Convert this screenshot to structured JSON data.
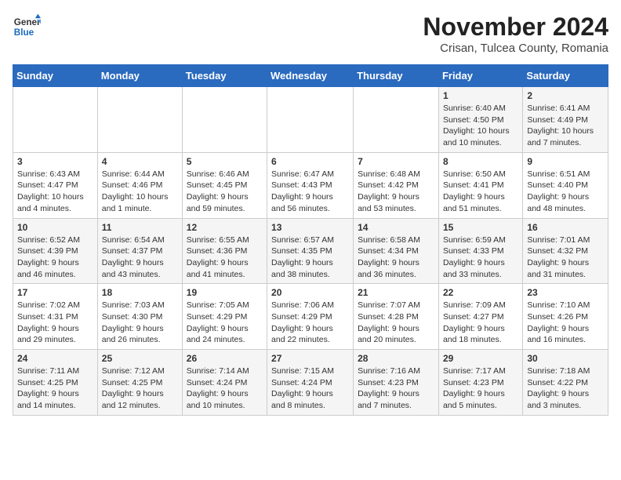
{
  "header": {
    "logo_line1": "General",
    "logo_line2": "Blue",
    "month_title": "November 2024",
    "location": "Crisan, Tulcea County, Romania"
  },
  "days_of_week": [
    "Sunday",
    "Monday",
    "Tuesday",
    "Wednesday",
    "Thursday",
    "Friday",
    "Saturday"
  ],
  "weeks": [
    [
      {
        "day": "",
        "info": ""
      },
      {
        "day": "",
        "info": ""
      },
      {
        "day": "",
        "info": ""
      },
      {
        "day": "",
        "info": ""
      },
      {
        "day": "",
        "info": ""
      },
      {
        "day": "1",
        "info": "Sunrise: 6:40 AM\nSunset: 4:50 PM\nDaylight: 10 hours and 10 minutes."
      },
      {
        "day": "2",
        "info": "Sunrise: 6:41 AM\nSunset: 4:49 PM\nDaylight: 10 hours and 7 minutes."
      }
    ],
    [
      {
        "day": "3",
        "info": "Sunrise: 6:43 AM\nSunset: 4:47 PM\nDaylight: 10 hours and 4 minutes."
      },
      {
        "day": "4",
        "info": "Sunrise: 6:44 AM\nSunset: 4:46 PM\nDaylight: 10 hours and 1 minute."
      },
      {
        "day": "5",
        "info": "Sunrise: 6:46 AM\nSunset: 4:45 PM\nDaylight: 9 hours and 59 minutes."
      },
      {
        "day": "6",
        "info": "Sunrise: 6:47 AM\nSunset: 4:43 PM\nDaylight: 9 hours and 56 minutes."
      },
      {
        "day": "7",
        "info": "Sunrise: 6:48 AM\nSunset: 4:42 PM\nDaylight: 9 hours and 53 minutes."
      },
      {
        "day": "8",
        "info": "Sunrise: 6:50 AM\nSunset: 4:41 PM\nDaylight: 9 hours and 51 minutes."
      },
      {
        "day": "9",
        "info": "Sunrise: 6:51 AM\nSunset: 4:40 PM\nDaylight: 9 hours and 48 minutes."
      }
    ],
    [
      {
        "day": "10",
        "info": "Sunrise: 6:52 AM\nSunset: 4:39 PM\nDaylight: 9 hours and 46 minutes."
      },
      {
        "day": "11",
        "info": "Sunrise: 6:54 AM\nSunset: 4:37 PM\nDaylight: 9 hours and 43 minutes."
      },
      {
        "day": "12",
        "info": "Sunrise: 6:55 AM\nSunset: 4:36 PM\nDaylight: 9 hours and 41 minutes."
      },
      {
        "day": "13",
        "info": "Sunrise: 6:57 AM\nSunset: 4:35 PM\nDaylight: 9 hours and 38 minutes."
      },
      {
        "day": "14",
        "info": "Sunrise: 6:58 AM\nSunset: 4:34 PM\nDaylight: 9 hours and 36 minutes."
      },
      {
        "day": "15",
        "info": "Sunrise: 6:59 AM\nSunset: 4:33 PM\nDaylight: 9 hours and 33 minutes."
      },
      {
        "day": "16",
        "info": "Sunrise: 7:01 AM\nSunset: 4:32 PM\nDaylight: 9 hours and 31 minutes."
      }
    ],
    [
      {
        "day": "17",
        "info": "Sunrise: 7:02 AM\nSunset: 4:31 PM\nDaylight: 9 hours and 29 minutes."
      },
      {
        "day": "18",
        "info": "Sunrise: 7:03 AM\nSunset: 4:30 PM\nDaylight: 9 hours and 26 minutes."
      },
      {
        "day": "19",
        "info": "Sunrise: 7:05 AM\nSunset: 4:29 PM\nDaylight: 9 hours and 24 minutes."
      },
      {
        "day": "20",
        "info": "Sunrise: 7:06 AM\nSunset: 4:29 PM\nDaylight: 9 hours and 22 minutes."
      },
      {
        "day": "21",
        "info": "Sunrise: 7:07 AM\nSunset: 4:28 PM\nDaylight: 9 hours and 20 minutes."
      },
      {
        "day": "22",
        "info": "Sunrise: 7:09 AM\nSunset: 4:27 PM\nDaylight: 9 hours and 18 minutes."
      },
      {
        "day": "23",
        "info": "Sunrise: 7:10 AM\nSunset: 4:26 PM\nDaylight: 9 hours and 16 minutes."
      }
    ],
    [
      {
        "day": "24",
        "info": "Sunrise: 7:11 AM\nSunset: 4:25 PM\nDaylight: 9 hours and 14 minutes."
      },
      {
        "day": "25",
        "info": "Sunrise: 7:12 AM\nSunset: 4:25 PM\nDaylight: 9 hours and 12 minutes."
      },
      {
        "day": "26",
        "info": "Sunrise: 7:14 AM\nSunset: 4:24 PM\nDaylight: 9 hours and 10 minutes."
      },
      {
        "day": "27",
        "info": "Sunrise: 7:15 AM\nSunset: 4:24 PM\nDaylight: 9 hours and 8 minutes."
      },
      {
        "day": "28",
        "info": "Sunrise: 7:16 AM\nSunset: 4:23 PM\nDaylight: 9 hours and 7 minutes."
      },
      {
        "day": "29",
        "info": "Sunrise: 7:17 AM\nSunset: 4:23 PM\nDaylight: 9 hours and 5 minutes."
      },
      {
        "day": "30",
        "info": "Sunrise: 7:18 AM\nSunset: 4:22 PM\nDaylight: 9 hours and 3 minutes."
      }
    ]
  ]
}
